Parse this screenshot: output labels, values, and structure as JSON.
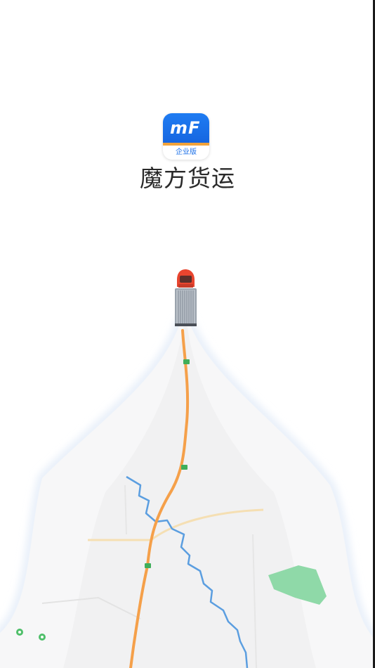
{
  "app": {
    "name": "魔方货运",
    "logo_mark": "mF",
    "logo_subtitle": "企业版"
  },
  "colors": {
    "brand_blue": "#1a6fe8",
    "accent_orange": "#f2a33a",
    "route": "#f5a04a",
    "river": "#5b9ee0",
    "park": "#8fd9a8"
  },
  "icons": {
    "truck": "truck-icon",
    "map_pin": "map-pin-icon"
  }
}
